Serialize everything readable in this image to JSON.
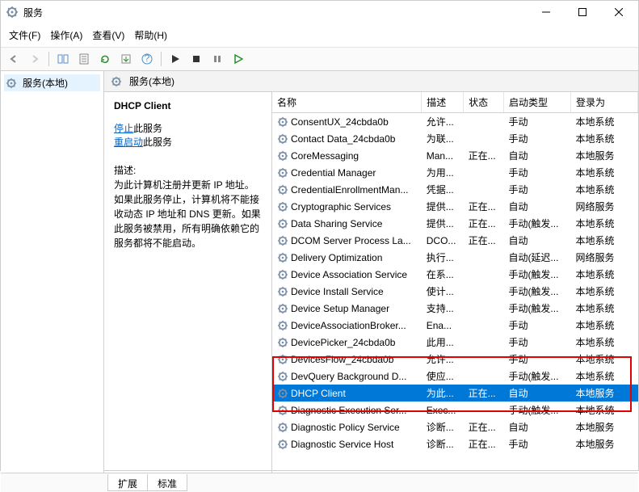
{
  "window": {
    "title": "服务"
  },
  "menu": {
    "file": "文件(F)",
    "action": "操作(A)",
    "view": "查看(V)",
    "help": "帮助(H)"
  },
  "nav": {
    "services_local": "服务(本地)"
  },
  "pane_header": "服务(本地)",
  "detail": {
    "title": "DHCP Client",
    "stop_link": "停止",
    "stop_suffix": "此服务",
    "restart_link": "重启动",
    "restart_suffix": "此服务",
    "desc_label": "描述:",
    "desc_text": "为此计算机注册并更新 IP 地址。如果此服务停止，计算机将不能接收动态 IP 地址和 DNS 更新。如果此服务被禁用，所有明确依赖它的服务都将不能启动。"
  },
  "columns": {
    "name": "名称",
    "desc": "描述",
    "status": "状态",
    "startup": "启动类型",
    "logon": "登录为"
  },
  "col_widths": {
    "name": "178px",
    "desc": "50px",
    "status": "48px",
    "startup": "80px",
    "logon": "80px"
  },
  "services": [
    {
      "name": "ConsentUX_24cbda0b",
      "desc": "允许...",
      "status": "",
      "startup": "手动",
      "logon": "本地系统"
    },
    {
      "name": "Contact Data_24cbda0b",
      "desc": "为联...",
      "status": "",
      "startup": "手动",
      "logon": "本地系统"
    },
    {
      "name": "CoreMessaging",
      "desc": "Man...",
      "status": "正在...",
      "startup": "自动",
      "logon": "本地服务"
    },
    {
      "name": "Credential Manager",
      "desc": "为用...",
      "status": "",
      "startup": "手动",
      "logon": "本地系统"
    },
    {
      "name": "CredentialEnrollmentMan...",
      "desc": "凭据...",
      "status": "",
      "startup": "手动",
      "logon": "本地系统"
    },
    {
      "name": "Cryptographic Services",
      "desc": "提供...",
      "status": "正在...",
      "startup": "自动",
      "logon": "网络服务"
    },
    {
      "name": "Data Sharing Service",
      "desc": "提供...",
      "status": "正在...",
      "startup": "手动(触发...",
      "logon": "本地系统"
    },
    {
      "name": "DCOM Server Process La...",
      "desc": "DCO...",
      "status": "正在...",
      "startup": "自动",
      "logon": "本地系统"
    },
    {
      "name": "Delivery Optimization",
      "desc": "执行...",
      "status": "",
      "startup": "自动(延迟...",
      "logon": "网络服务"
    },
    {
      "name": "Device Association Service",
      "desc": "在系...",
      "status": "",
      "startup": "手动(触发...",
      "logon": "本地系统"
    },
    {
      "name": "Device Install Service",
      "desc": "使计...",
      "status": "",
      "startup": "手动(触发...",
      "logon": "本地系统"
    },
    {
      "name": "Device Setup Manager",
      "desc": "支持...",
      "status": "",
      "startup": "手动(触发...",
      "logon": "本地系统"
    },
    {
      "name": "DeviceAssociationBroker...",
      "desc": "Ena...",
      "status": "",
      "startup": "手动",
      "logon": "本地系统"
    },
    {
      "name": "DevicePicker_24cbda0b",
      "desc": "此用...",
      "status": "",
      "startup": "手动",
      "logon": "本地系统"
    },
    {
      "name": "DevicesFlow_24cbda0b",
      "desc": "允许...",
      "status": "",
      "startup": "手动",
      "logon": "本地系统"
    },
    {
      "name": "DevQuery Background D...",
      "desc": "使应...",
      "status": "",
      "startup": "手动(触发...",
      "logon": "本地系统"
    },
    {
      "name": "DHCP Client",
      "desc": "为此...",
      "status": "正在...",
      "startup": "自动",
      "logon": "本地服务",
      "selected": true
    },
    {
      "name": "Diagnostic Execution Ser...",
      "desc": "Exec...",
      "status": "",
      "startup": "手动(触发...",
      "logon": "本地系统"
    },
    {
      "name": "Diagnostic Policy Service",
      "desc": "诊断...",
      "status": "正在...",
      "startup": "自动",
      "logon": "本地服务"
    },
    {
      "name": "Diagnostic Service Host",
      "desc": "诊断...",
      "status": "正在...",
      "startup": "手动",
      "logon": "本地服务"
    }
  ],
  "tabs": {
    "extended": "扩展",
    "standard": "标准"
  }
}
